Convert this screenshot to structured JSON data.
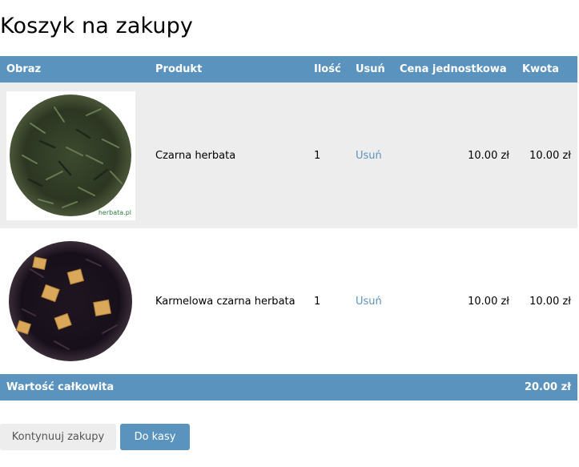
{
  "page": {
    "title": "Koszyk na zakupy"
  },
  "cart": {
    "headers": {
      "image": "Obraz",
      "product": "Produkt",
      "quantity": "Ilość",
      "remove": "Usuń",
      "unit_price": "Cena jednostkowa",
      "amount": "Kwota"
    },
    "items": [
      {
        "image_icon": "black-tea-leaves-image",
        "image_watermark": "herbata.pl",
        "name": "Czarna herbata",
        "quantity": "1",
        "remove_label": "Usuń",
        "unit_price": "10.00 zł",
        "amount": "10.00 zł"
      },
      {
        "image_icon": "caramel-black-tea-image",
        "name": "Karmelowa czarna herbata",
        "quantity": "1",
        "remove_label": "Usuń",
        "unit_price": "10.00 zł",
        "amount": "10.00 zł"
      }
    ],
    "total": {
      "label": "Wartość całkowita",
      "value": "20.00 zł"
    }
  },
  "actions": {
    "continue_label": "Kontynuuj zakupy",
    "checkout_label": "Do kasy"
  },
  "colors": {
    "accent": "#5b93bf",
    "row_alt": "#ededed",
    "button_secondary": "#ededed"
  }
}
